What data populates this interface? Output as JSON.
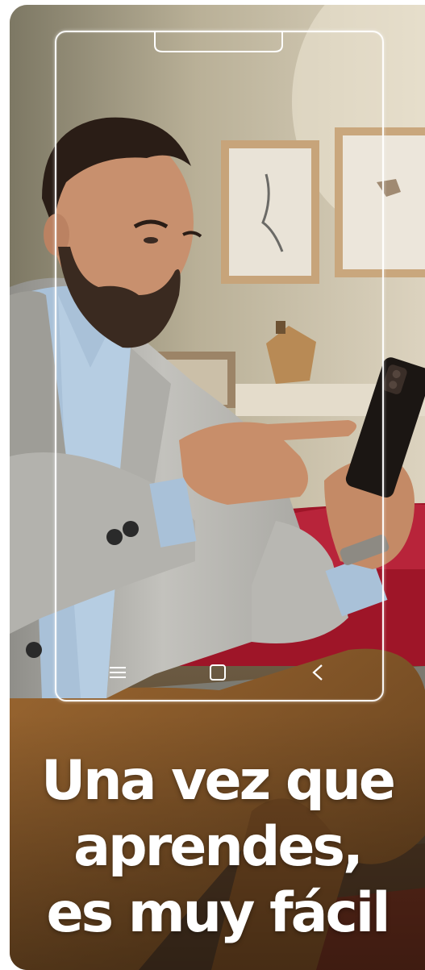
{
  "headline": {
    "line1": "Una vez que",
    "line2": "aprendes,",
    "line3": "es muy fácil"
  },
  "nav": {
    "menu_icon": "menu-icon",
    "home_icon": "home-square-icon",
    "back_icon": "back-chevron-icon"
  },
  "colors": {
    "wall": "#c9bea3",
    "blazer": "#b9b8b3",
    "shirt": "#a9c1d8",
    "trousers": "#8a5a2a",
    "sofa_red": "#a1182a",
    "frame_line": "#ffffff",
    "headline": "#ffffff"
  }
}
